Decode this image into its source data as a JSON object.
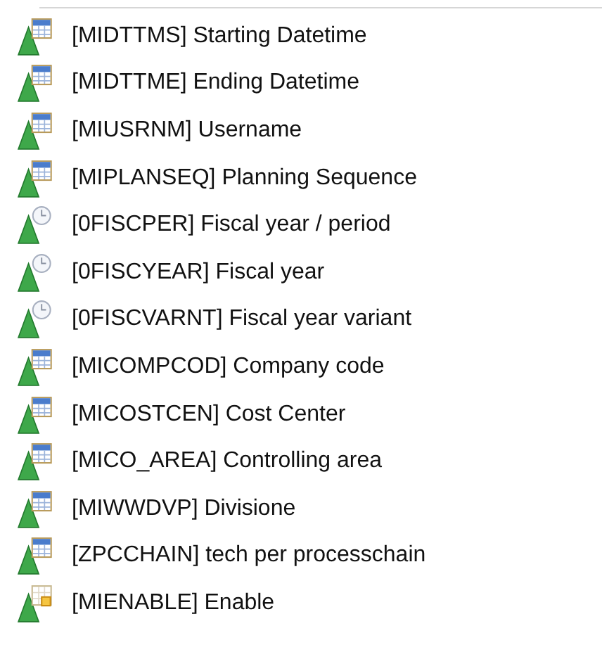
{
  "items": [
    {
      "kind": "table",
      "label": "[MIDTTMS] Starting Datetime"
    },
    {
      "kind": "table",
      "label": "[MIDTTME] Ending Datetime"
    },
    {
      "kind": "table",
      "label": "[MIUSRNM] Username"
    },
    {
      "kind": "table",
      "label": "[MIPLANSEQ] Planning Sequence"
    },
    {
      "kind": "time",
      "label": "[0FISCPER] Fiscal year / period"
    },
    {
      "kind": "time",
      "label": "[0FISCYEAR] Fiscal year"
    },
    {
      "kind": "time",
      "label": "[0FISCVARNT] Fiscal year variant"
    },
    {
      "kind": "table",
      "label": "[MICOMPCOD] Company code"
    },
    {
      "kind": "table",
      "label": "[MICOSTCEN] Cost Center"
    },
    {
      "kind": "table",
      "label": "[MICO_AREA] Controlling area"
    },
    {
      "kind": "table",
      "label": "[MIWWDVP] Divisione"
    },
    {
      "kind": "table",
      "label": "[ZPCCHAIN] tech per processchain"
    },
    {
      "kind": "flag",
      "label": "[MIENABLE] Enable"
    }
  ]
}
